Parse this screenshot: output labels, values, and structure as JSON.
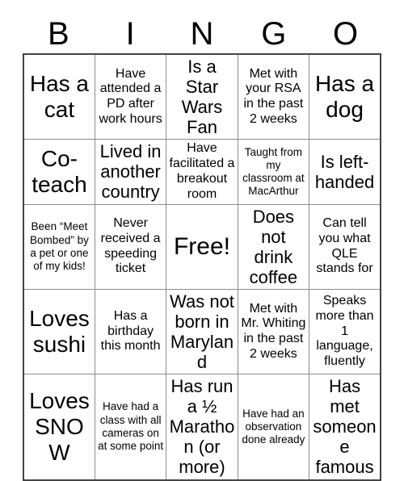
{
  "card": {
    "title": "BINGO",
    "header_letters": [
      "B",
      "I",
      "N",
      "G",
      "O"
    ],
    "colors": {
      "background": "#ffffff",
      "text": "#000000",
      "outer_border": "#444444",
      "inner_border": "#8c8c8c"
    },
    "rows": [
      [
        {
          "text": "Has a cat",
          "size": "xl"
        },
        {
          "text": "Have attended a PD after work hours",
          "size": "md"
        },
        {
          "text": "Is a Star Wars Fan",
          "size": "lg"
        },
        {
          "text": "Met with your RSA in the past 2 weeks",
          "size": "md"
        },
        {
          "text": "Has a dog",
          "size": "xl"
        }
      ],
      [
        {
          "text": "Co-teach",
          "size": "xl"
        },
        {
          "text": "Lived in another country",
          "size": "lg"
        },
        {
          "text": "Have facilitated a breakout room",
          "size": "md"
        },
        {
          "text": "Taught from my classroom at MacArthur",
          "size": "sm"
        },
        {
          "text": "Is left-handed",
          "size": "lg"
        }
      ],
      [
        {
          "text": "Been “Meet Bombed” by a pet or one of my kids!",
          "size": "sm"
        },
        {
          "text": "Never received a speeding ticket",
          "size": "md"
        },
        {
          "text": "Free!",
          "size": "free"
        },
        {
          "text": "Does not drink coffee",
          "size": "lg"
        },
        {
          "text": "Can tell you what QLE stands for",
          "size": "md"
        }
      ],
      [
        {
          "text": "Loves sushi",
          "size": "xl"
        },
        {
          "text": "Has a birthday this month",
          "size": "md"
        },
        {
          "text": "Was not born in Maryland",
          "size": "lg"
        },
        {
          "text": "Met with Mr. Whiting in the past 2 weeks",
          "size": "md"
        },
        {
          "text": "Speaks more than 1 language, fluently",
          "size": "md"
        }
      ],
      [
        {
          "text": "Loves SNOW",
          "size": "xl"
        },
        {
          "text": "Have had a class with all cameras on at some point",
          "size": "sm"
        },
        {
          "text": "Has run a ½ Marathon (or more)",
          "size": "lg"
        },
        {
          "text": "Have had an observation done already",
          "size": "sm"
        },
        {
          "text": "Has met someone famous",
          "size": "lg"
        }
      ]
    ]
  }
}
